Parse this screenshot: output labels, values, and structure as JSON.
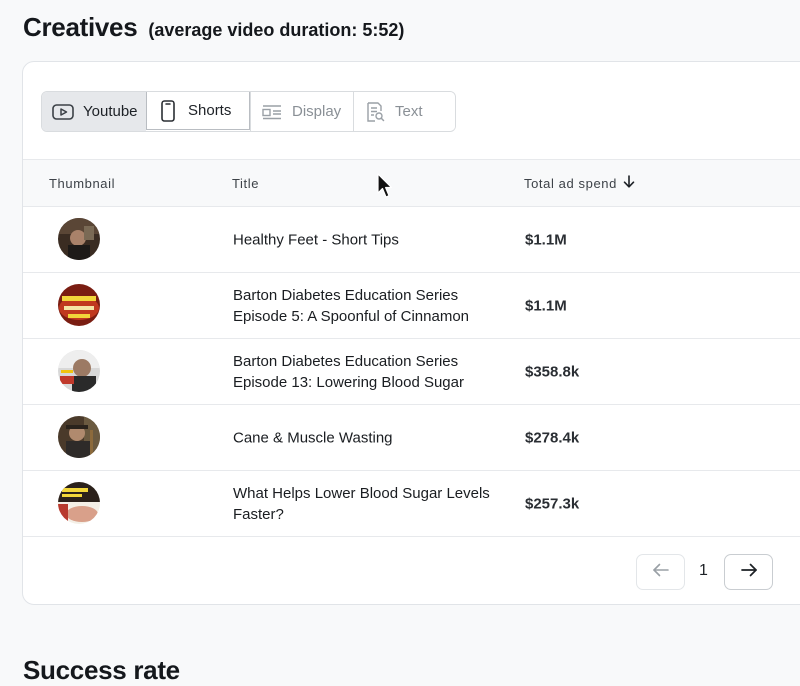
{
  "header": {
    "title": "Creatives",
    "subtitle": "(average video duration: 5:52)"
  },
  "tabs": [
    {
      "label": "Youtube",
      "icon": "youtube-icon",
      "state": "selected"
    },
    {
      "label": "Shorts",
      "icon": "phone-icon",
      "state": "hover"
    },
    {
      "label": "Display",
      "icon": "display-icon",
      "state": "normal"
    },
    {
      "label": "Text",
      "icon": "text-document-icon",
      "state": "normal"
    }
  ],
  "table": {
    "columns": [
      "Thumbnail",
      "Title",
      "Total ad spend"
    ],
    "sort_column": "Total ad spend",
    "sort_direction": "descending",
    "rows": [
      {
        "title": "Healthy Feet - Short Tips",
        "spend": "$1.1M"
      },
      {
        "title": "Barton Diabetes Education Series Episode 5: A Spoonful of Cinnamon",
        "spend": "$1.1M"
      },
      {
        "title": "Barton Diabetes Education Series Episode 13: Lowering Blood Sugar",
        "spend": "$358.8k"
      },
      {
        "title": "Cane & Muscle Wasting",
        "spend": "$278.4k"
      },
      {
        "title": "What Helps Lower Blood Sugar Levels Faster?",
        "spend": "$257.3k"
      }
    ]
  },
  "pagination": {
    "current_page": "1"
  },
  "next_section": {
    "title": "Success rate"
  },
  "colors": {
    "page_background": "#f8f9fa",
    "card_background": "#ffffff",
    "selected_tab": "#e6e8eb",
    "border": "#e1e4e8"
  }
}
